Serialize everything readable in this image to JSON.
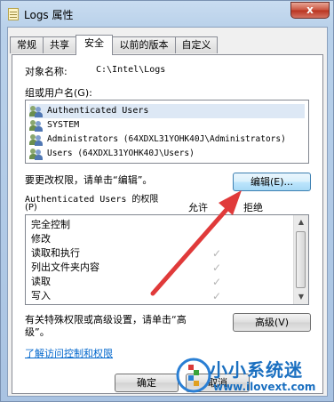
{
  "window": {
    "title": "Logs 属性",
    "close_glyph": "x"
  },
  "tabs": [
    "常规",
    "共享",
    "安全",
    "以前的版本",
    "自定义"
  ],
  "object": {
    "label": "对象名称:",
    "value": "C:\\Intel\\Logs"
  },
  "groups": {
    "label": "组或用户名(G):",
    "items": [
      "Authenticated Users",
      "SYSTEM",
      "Administrators (64XDXL31YOHK40J\\Administrators)",
      "Users (64XDXL31YOHK40J\\Users)"
    ]
  },
  "change_hint": "要更改权限，请单击“编辑”。",
  "edit_button": "编辑(E)...",
  "permissions": {
    "title": "Authenticated Users 的权限",
    "title_key": "(P)",
    "allow_header": "允许",
    "deny_header": "拒绝",
    "items": [
      "完全控制",
      "修改",
      "读取和执行",
      "列出文件夹内容",
      "读取",
      "写入"
    ],
    "allowed": [
      false,
      false,
      true,
      true,
      true,
      true
    ],
    "check_glyph": "✓"
  },
  "special": {
    "text_line1": "有关特殊权限或高级设置，请单击“高",
    "text_line2": "级”。",
    "advanced_button": "高级(V)"
  },
  "learn_link": "了解访问控制和权限",
  "footer": {
    "ok_button": "确定",
    "cancel_fragment": "取消"
  },
  "watermark": {
    "name": "小小系统迷",
    "url": "www.ilovext.com"
  },
  "colors": {
    "accent_arrow": "#e03a3a"
  }
}
